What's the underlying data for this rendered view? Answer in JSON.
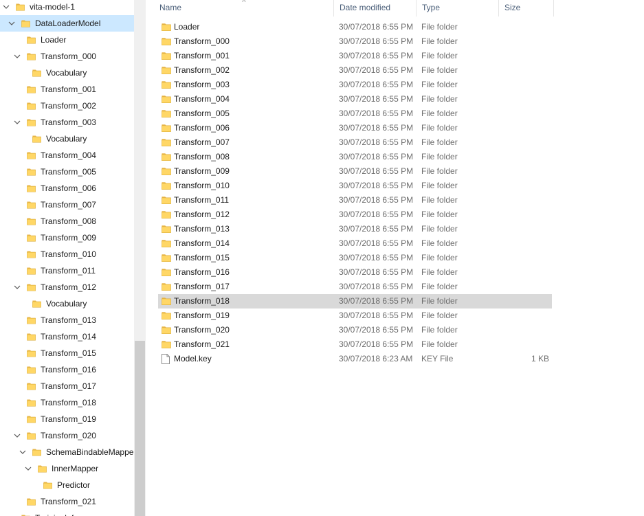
{
  "columns": {
    "name": "Name",
    "date": "Date modified",
    "type": "Type",
    "size": "Size"
  },
  "nav": {
    "items": [
      {
        "label": "vita-model-1",
        "level": 0,
        "expanded": true
      },
      {
        "label": "DataLoaderModel",
        "level": 1,
        "expanded": true,
        "selected": true
      },
      {
        "label": "Loader",
        "level": 2
      },
      {
        "label": "Transform_000",
        "level": 2,
        "expanded": true
      },
      {
        "label": "Vocabulary",
        "level": 3
      },
      {
        "label": "Transform_001",
        "level": 2
      },
      {
        "label": "Transform_002",
        "level": 2
      },
      {
        "label": "Transform_003",
        "level": 2,
        "expanded": true
      },
      {
        "label": "Vocabulary",
        "level": 3
      },
      {
        "label": "Transform_004",
        "level": 2
      },
      {
        "label": "Transform_005",
        "level": 2
      },
      {
        "label": "Transform_006",
        "level": 2
      },
      {
        "label": "Transform_007",
        "level": 2
      },
      {
        "label": "Transform_008",
        "level": 2
      },
      {
        "label": "Transform_009",
        "level": 2
      },
      {
        "label": "Transform_010",
        "level": 2
      },
      {
        "label": "Transform_011",
        "level": 2
      },
      {
        "label": "Transform_012",
        "level": 2,
        "expanded": true
      },
      {
        "label": "Vocabulary",
        "level": 3
      },
      {
        "label": "Transform_013",
        "level": 2
      },
      {
        "label": "Transform_014",
        "level": 2
      },
      {
        "label": "Transform_015",
        "level": 2
      },
      {
        "label": "Transform_016",
        "level": 2
      },
      {
        "label": "Transform_017",
        "level": 2
      },
      {
        "label": "Transform_018",
        "level": 2
      },
      {
        "label": "Transform_019",
        "level": 2
      },
      {
        "label": "Transform_020",
        "level": 2,
        "expanded": true
      },
      {
        "label": "SchemaBindableMapper",
        "level": 3,
        "expanded": true
      },
      {
        "label": "InnerMapper",
        "level": 4,
        "expanded": true
      },
      {
        "label": "Predictor",
        "level": 5
      },
      {
        "label": "Transform_021",
        "level": 2
      },
      {
        "label": "TrainingInfo",
        "level": 1
      }
    ]
  },
  "files": [
    {
      "name": "Loader",
      "date": "30/07/2018 6:55 PM",
      "type": "File folder",
      "size": "",
      "icon": "folder-icon"
    },
    {
      "name": "Transform_000",
      "date": "30/07/2018 6:55 PM",
      "type": "File folder",
      "size": "",
      "icon": "folder-icon"
    },
    {
      "name": "Transform_001",
      "date": "30/07/2018 6:55 PM",
      "type": "File folder",
      "size": "",
      "icon": "folder-icon"
    },
    {
      "name": "Transform_002",
      "date": "30/07/2018 6:55 PM",
      "type": "File folder",
      "size": "",
      "icon": "folder-icon"
    },
    {
      "name": "Transform_003",
      "date": "30/07/2018 6:55 PM",
      "type": "File folder",
      "size": "",
      "icon": "folder-icon"
    },
    {
      "name": "Transform_004",
      "date": "30/07/2018 6:55 PM",
      "type": "File folder",
      "size": "",
      "icon": "folder-icon"
    },
    {
      "name": "Transform_005",
      "date": "30/07/2018 6:55 PM",
      "type": "File folder",
      "size": "",
      "icon": "folder-icon"
    },
    {
      "name": "Transform_006",
      "date": "30/07/2018 6:55 PM",
      "type": "File folder",
      "size": "",
      "icon": "folder-icon"
    },
    {
      "name": "Transform_007",
      "date": "30/07/2018 6:55 PM",
      "type": "File folder",
      "size": "",
      "icon": "folder-icon"
    },
    {
      "name": "Transform_008",
      "date": "30/07/2018 6:55 PM",
      "type": "File folder",
      "size": "",
      "icon": "folder-icon"
    },
    {
      "name": "Transform_009",
      "date": "30/07/2018 6:55 PM",
      "type": "File folder",
      "size": "",
      "icon": "folder-icon"
    },
    {
      "name": "Transform_010",
      "date": "30/07/2018 6:55 PM",
      "type": "File folder",
      "size": "",
      "icon": "folder-icon"
    },
    {
      "name": "Transform_011",
      "date": "30/07/2018 6:55 PM",
      "type": "File folder",
      "size": "",
      "icon": "folder-icon"
    },
    {
      "name": "Transform_012",
      "date": "30/07/2018 6:55 PM",
      "type": "File folder",
      "size": "",
      "icon": "folder-icon"
    },
    {
      "name": "Transform_013",
      "date": "30/07/2018 6:55 PM",
      "type": "File folder",
      "size": "",
      "icon": "folder-icon"
    },
    {
      "name": "Transform_014",
      "date": "30/07/2018 6:55 PM",
      "type": "File folder",
      "size": "",
      "icon": "folder-icon"
    },
    {
      "name": "Transform_015",
      "date": "30/07/2018 6:55 PM",
      "type": "File folder",
      "size": "",
      "icon": "folder-icon"
    },
    {
      "name": "Transform_016",
      "date": "30/07/2018 6:55 PM",
      "type": "File folder",
      "size": "",
      "icon": "folder-icon"
    },
    {
      "name": "Transform_017",
      "date": "30/07/2018 6:55 PM",
      "type": "File folder",
      "size": "",
      "icon": "folder-icon"
    },
    {
      "name": "Transform_018",
      "date": "30/07/2018 6:55 PM",
      "type": "File folder",
      "size": "",
      "icon": "folder-icon",
      "selected": true
    },
    {
      "name": "Transform_019",
      "date": "30/07/2018 6:55 PM",
      "type": "File folder",
      "size": "",
      "icon": "folder-icon"
    },
    {
      "name": "Transform_020",
      "date": "30/07/2018 6:55 PM",
      "type": "File folder",
      "size": "",
      "icon": "folder-icon"
    },
    {
      "name": "Transform_021",
      "date": "30/07/2018 6:55 PM",
      "type": "File folder",
      "size": "",
      "icon": "folder-icon"
    },
    {
      "name": "Model.key",
      "date": "30/07/2018 6:23 AM",
      "type": "KEY File",
      "size": "1 KB",
      "icon": "file-icon"
    }
  ],
  "colors": {
    "selected_nav": "#cce8ff",
    "selected_row": "#d9d9d9",
    "folder_fill": "#ffd766",
    "header_text": "#4c607a"
  }
}
